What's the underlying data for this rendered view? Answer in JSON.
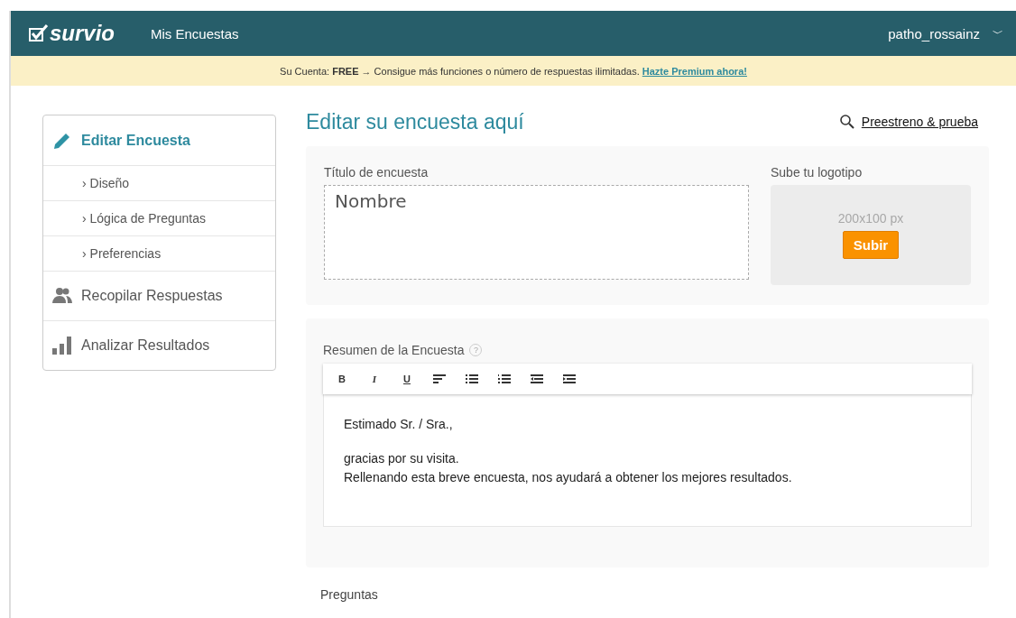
{
  "header": {
    "logo": "survio",
    "nav_link": "Mis Encuestas",
    "user": "patho_rossainz",
    "user_menu": "﹀"
  },
  "banner": {
    "text": "Su Cuenta: **FREE** → Consigue más funciones o número de respuestas ilimitadas.",
    "link": "Hazte Premium ahora!"
  },
  "sidebar": {
    "items": [
      {
        "kind": "main",
        "label": "Editar Encuesta",
        "selected": true
      },
      {
        "kind": "sub",
        "label": "› Diseño",
        "selected": false
      },
      {
        "kind": "sub",
        "label": "› Lógica de Preguntas",
        "selected": false
      },
      {
        "kind": "sub",
        "label": "› Preferencias",
        "selected": false
      },
      {
        "kind": "main",
        "label": "Recopilar Respuestas",
        "selected": false
      },
      {
        "kind": "main",
        "label": "Analizar Resultados",
        "selected": false
      }
    ]
  },
  "main": {
    "title": "Editar su encuesta aquí",
    "preview_link": "Preestreno & prueba",
    "title_field": {
      "label": "Título de encuesta",
      "value": "Nombre"
    },
    "logo_upload": {
      "label": "Sube tu logotipo",
      "hint": "200x100 px",
      "button": "Subir"
    },
    "summary": {
      "label": "Resumen de la Encuesta",
      "help": "?",
      "toolbar": [
        {
          "kind": "bold",
          "label": "B"
        },
        {
          "kind": "italic",
          "label": "I"
        },
        {
          "kind": "underline",
          "label": "U"
        },
        {
          "kind": "align-left"
        },
        {
          "kind": "bullet-list"
        },
        {
          "kind": "numbered-list"
        },
        {
          "kind": "outdent"
        },
        {
          "kind": "indent"
        }
      ],
      "paragraphs": [
        [
          "Estimado Sr. / Sra.,"
        ],
        [
          "gracias por su visita.",
          "Rellenando esta breve encuesta, nos ayudará a obtener los mejores resultados."
        ]
      ]
    },
    "questions_label": "Preguntas"
  }
}
